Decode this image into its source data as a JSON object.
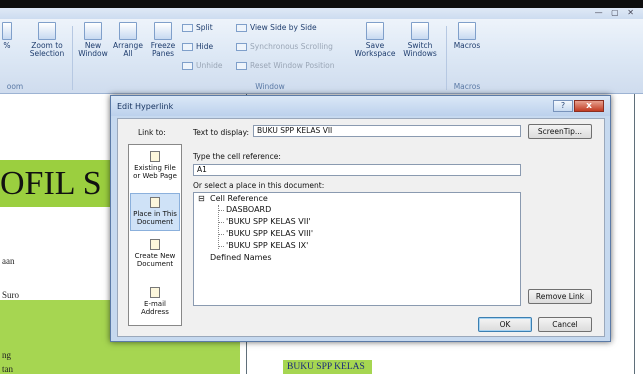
{
  "ribbon": {
    "window_controls": "— ▢ ✕",
    "buttons": {
      "zoom_selection": "Zoom to Selection",
      "pct": "%",
      "new_window": "New Window",
      "arrange_all": "Arrange All",
      "freeze_panes": "Freeze Panes",
      "split": "Split",
      "hide": "Hide",
      "unhide": "Unhide",
      "view_side": "View Side by Side",
      "sync_scroll": "Synchronous Scrolling",
      "reset_window": "Reset Window Position",
      "save_workspace": "Save Workspace",
      "switch_windows": "Switch Windows",
      "macros": "Macros"
    },
    "groups": {
      "zoom": "oom",
      "window": "Window",
      "macros": "Macros"
    }
  },
  "sheet": {
    "banner_text": "OFIL S",
    "left_text_1": "aan",
    "left_text_2": "Suro",
    "left_text_3": "ng",
    "left_text_4": "tan",
    "cell_link_text": "BUKU SPP KELAS IX"
  },
  "dialog": {
    "title": "Edit Hyperlink",
    "help_symbol": "?",
    "close_symbol": "x",
    "link_to_label": "Link to:",
    "link_types": [
      {
        "label": "Existing File or Web Page",
        "icon": "globe-page-icon"
      },
      {
        "label": "Place in This Document",
        "icon": "document-place-icon"
      },
      {
        "label": "Create New Document",
        "icon": "new-document-icon"
      },
      {
        "label": "E-mail Address",
        "icon": "email-icon"
      }
    ],
    "text_to_display_label": "Text to display:",
    "text_to_display_value": "BUKU SPP KELAS VII",
    "screentip_label": "ScreenTip...",
    "cell_ref_label": "Type the cell reference:",
    "cell_ref_value": "A1",
    "place_label": "Or select a place in this document:",
    "tree": {
      "cell_reference": "Cell Reference",
      "items": [
        "DASBOARD",
        "'BUKU SPP KELAS VII'",
        "'BUKU SPP KELAS VIII'",
        "'BUKU SPP KELAS IX'"
      ],
      "defined_names": "Defined Names",
      "expander": "⊟"
    },
    "remove_link_label": "Remove Link",
    "ok_label": "OK",
    "cancel_label": "Cancel"
  }
}
